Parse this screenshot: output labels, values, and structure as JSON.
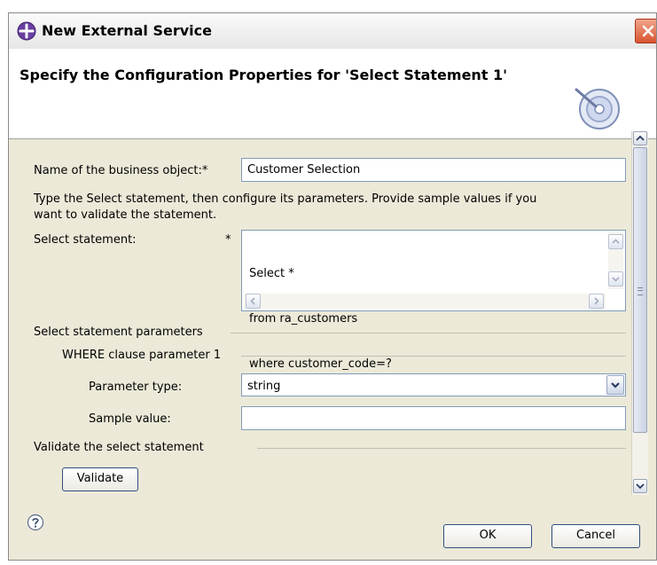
{
  "window": {
    "title": "New External Service"
  },
  "banner": {
    "title": "Specify the Configuration Properties for 'Select Statement 1'"
  },
  "form": {
    "bo_name_label": "Name of the business object:*",
    "bo_name_value": "Customer Selection",
    "instructions_line1": "Type the Select statement, then configure its parameters. Provide sample values if you",
    "instructions_line2": "want to validate the statement.",
    "select_label": "Select statement:",
    "required_mark": "*",
    "select_value_line1": "Select *",
    "select_value_line2": "from ra_customers",
    "select_value_line3": "where customer_code=?",
    "params_group_label": "Select statement parameters",
    "where_group_label": "WHERE clause parameter 1",
    "param_type_label": "Parameter type:",
    "param_type_value": "string",
    "sample_value_label": "Sample value:",
    "sample_value": "",
    "validate_group_label": "Validate the select statement",
    "validate_button": "Validate"
  },
  "footer": {
    "ok_button": "OK",
    "cancel_button": "Cancel"
  },
  "icons": {
    "app": "wizard-app-icon",
    "close": "close-icon",
    "banner": "dial-wizard-icon",
    "help": "help-icon"
  },
  "colors": {
    "dialog_bg": "#ece9d8",
    "close_button": "#d9542f",
    "field_border": "#7f9db9",
    "button_border": "#2e4e7e"
  }
}
